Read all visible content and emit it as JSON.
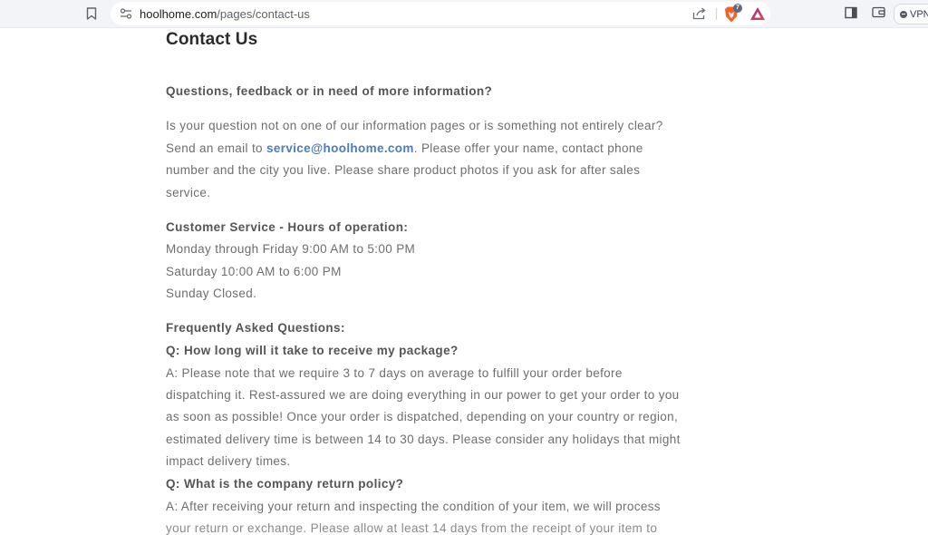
{
  "browser": {
    "url_host": "hoolhome.com",
    "url_path": "/pages/contact-us",
    "brave_shield_count": "7",
    "vpn_label": "VPN"
  },
  "page": {
    "title": "Contact Us",
    "intro_heading": "Questions, feedback or in need of more information?",
    "intro": {
      "line1": "Is your question not on one of our information pages or is something not entirely clear?",
      "line2_prefix": "Send an email to ",
      "email": "service@hoolhome.com",
      "line2_suffix": ". Please offer your name, contact phone",
      "line3": "number and the city you live. Please share product photos if you ask for after sales",
      "line4": "service."
    },
    "hours": {
      "heading": "Customer Service - Hours of operation:",
      "lines": [
        "Monday through Friday 9:00 AM to 5:00 PM",
        "Saturday 10:00 AM to 6:00 PM",
        "Sunday Closed."
      ]
    },
    "faq": {
      "heading": "Frequently Asked Questions:",
      "items": [
        {
          "question": "Q: How long will it take to receive my package?",
          "answer_lines": [
            "A: Please note that we require 3 to 7 days on average to fulfill your order before",
            "dispatching it. Rest-assured we are doing everything in our power to get your order to you",
            "as soon as possible! Once your order is dispatched, depending on your country or region,",
            "estimated delivery time is between 14 to 30 days. Please consider any holidays that might",
            "impact delivery times."
          ]
        },
        {
          "question": "Q: What is the company return policy?",
          "answer_lines": [
            "A: After receiving your return and inspecting the condition of your item, we will process",
            "your return or exchange. Please allow at least 14 days from the receipt of your item to"
          ]
        }
      ]
    }
  }
}
